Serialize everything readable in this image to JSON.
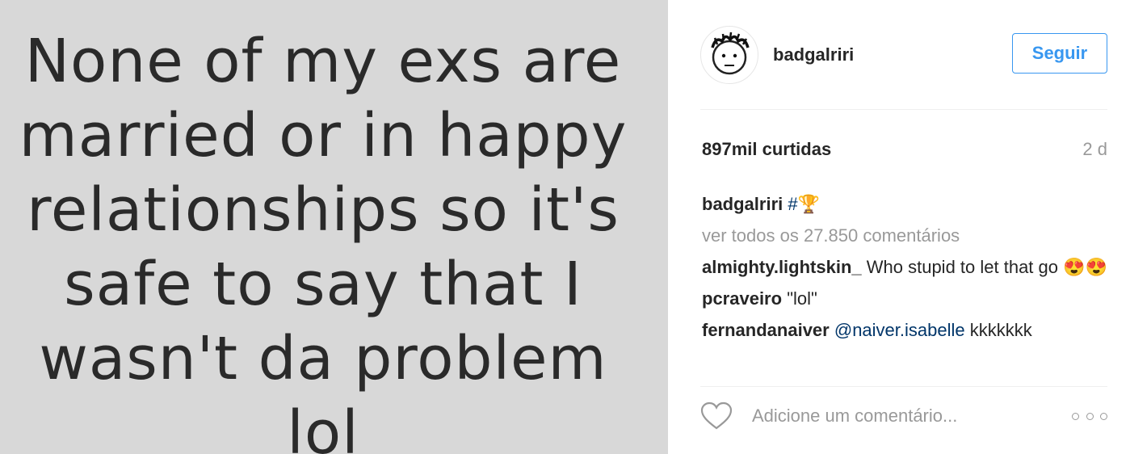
{
  "media": {
    "text": "None of my exs are\nmarried or in happy\nrelationships so it's\nsafe to say that I\nwasn't da problem\nlol"
  },
  "header": {
    "username": "badgalriri",
    "follow_label": "Seguir",
    "avatar_icon": "cartoon-face-avatar-icon"
  },
  "stats": {
    "likes": "897mil curtidas",
    "age": "2 d"
  },
  "caption": {
    "author": "badgalriri",
    "hashtag": "#",
    "hashtag_emoji": "🏆"
  },
  "view_all_comments": "ver todos os 27.850 comentários",
  "comments": [
    {
      "author": "almighty.lightskin_",
      "text": "Who stupid to let that go 😍😍"
    },
    {
      "author": "pcraveiro",
      "text": "\"lol\""
    },
    {
      "author": "fernandanaiver",
      "mention": "@naiver.isabelle",
      "text": "kkkkkkk"
    }
  ],
  "composer": {
    "placeholder": "Adicione um comentário...",
    "like_icon": "heart-icon",
    "more_icon": "more-options-icon"
  },
  "colors": {
    "accent": "#3897f0",
    "text": "#262626",
    "muted": "#999999",
    "media_bg": "#d8d8d8"
  }
}
